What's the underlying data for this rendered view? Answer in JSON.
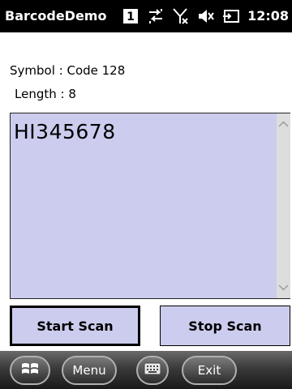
{
  "titlebar": {
    "app_title": "BarcodeDemo",
    "clock": "12:08",
    "status_icons": [
      "notification-1-icon",
      "data-connection-icon",
      "no-signal-icon",
      "volume-mute-icon",
      "battery-charging-icon"
    ],
    "notification_count": "1"
  },
  "info": {
    "symbol_line": "Symbol : Code 128",
    "length_line": "Length : 8"
  },
  "result": {
    "value": "HI345678"
  },
  "buttons": {
    "start_label": "Start Scan",
    "stop_label": "Stop Scan"
  },
  "menubar": {
    "menu_label": "Menu",
    "exit_label": "Exit"
  },
  "colors": {
    "textarea_bg": "#ccccee",
    "titlebar_bg": "#000000"
  }
}
